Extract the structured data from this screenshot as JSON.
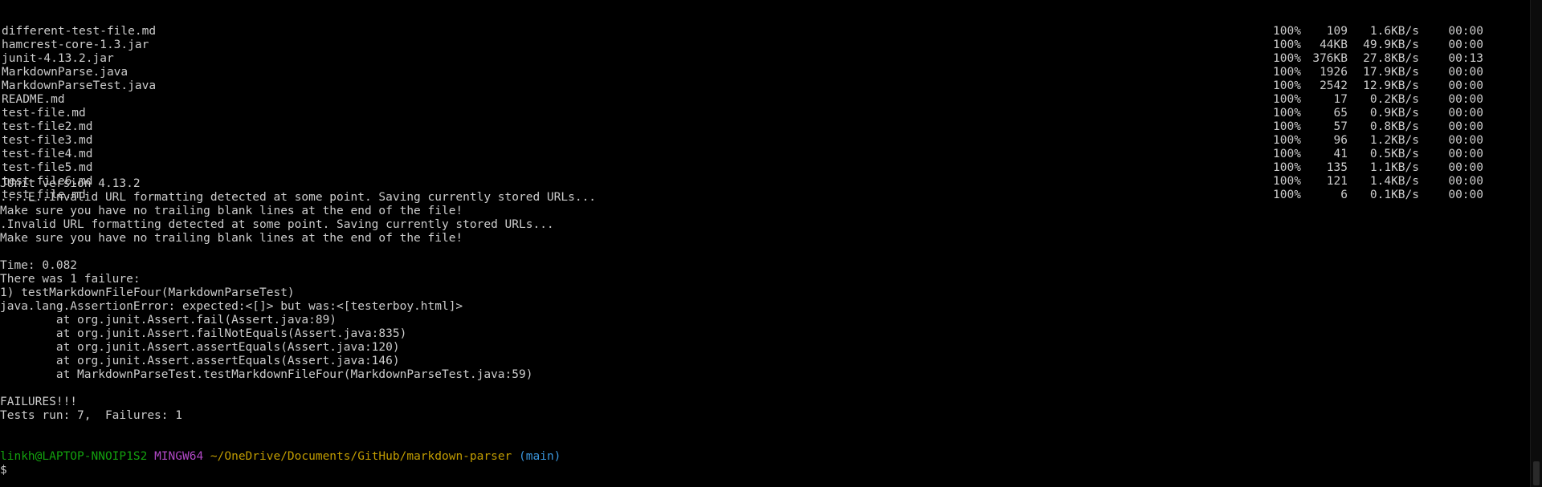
{
  "transfers": [
    {
      "file": "different-test-file.md",
      "percent": "100%",
      "size": "109",
      "rate": "1.6KB/s",
      "eta": "00:00"
    },
    {
      "file": "hamcrest-core-1.3.jar",
      "percent": "100%",
      "size": "44KB",
      "rate": "49.9KB/s",
      "eta": "00:00"
    },
    {
      "file": "junit-4.13.2.jar",
      "percent": "100%",
      "size": "376KB",
      "rate": "27.8KB/s",
      "eta": "00:13"
    },
    {
      "file": "MarkdownParse.java",
      "percent": "100%",
      "size": "1926",
      "rate": "17.9KB/s",
      "eta": "00:00"
    },
    {
      "file": "MarkdownParseTest.java",
      "percent": "100%",
      "size": "2542",
      "rate": "12.9KB/s",
      "eta": "00:00"
    },
    {
      "file": "README.md",
      "percent": "100%",
      "size": "17",
      "rate": "0.2KB/s",
      "eta": "00:00"
    },
    {
      "file": "test-file.md",
      "percent": "100%",
      "size": "65",
      "rate": "0.9KB/s",
      "eta": "00:00"
    },
    {
      "file": "test-file2.md",
      "percent": "100%",
      "size": "57",
      "rate": "0.8KB/s",
      "eta": "00:00"
    },
    {
      "file": "test-file3.md",
      "percent": "100%",
      "size": "96",
      "rate": "1.2KB/s",
      "eta": "00:00"
    },
    {
      "file": "test-file4.md",
      "percent": "100%",
      "size": "41",
      "rate": "0.5KB/s",
      "eta": "00:00"
    },
    {
      "file": "test-file5.md",
      "percent": "100%",
      "size": "135",
      "rate": "1.1KB/s",
      "eta": "00:00"
    },
    {
      "file": "test-file6.md",
      "percent": "100%",
      "size": "121",
      "rate": "1.4KB/s",
      "eta": "00:00"
    },
    {
      "file": "test_file.md",
      "percent": "100%",
      "size": "6",
      "rate": "0.1KB/s",
      "eta": "00:00"
    }
  ],
  "output": {
    "junit_version": "JUnit version 4.13.2",
    "run_line_1": "....E..Invalid URL formatting detected at some point. Saving currently stored URLs...",
    "warn_line_1": "Make sure you have no trailing blank lines at the end of the file!",
    "run_line_2": ".Invalid URL formatting detected at some point. Saving currently stored URLs...",
    "warn_line_2": "Make sure you have no trailing blank lines at the end of the file!",
    "time": "Time: 0.082",
    "failure_count": "There was 1 failure:",
    "failure_test": "1) testMarkdownFileFour(MarkdownParseTest)",
    "assertion_error": "java.lang.AssertionError: expected:<[]> but was:<[testerboy.html]>",
    "stack": [
      "        at org.junit.Assert.fail(Assert.java:89)",
      "        at org.junit.Assert.failNotEquals(Assert.java:835)",
      "        at org.junit.Assert.assertEquals(Assert.java:120)",
      "        at org.junit.Assert.assertEquals(Assert.java:146)",
      "        at MarkdownParseTest.testMarkdownFileFour(MarkdownParseTest.java:59)"
    ],
    "failures_banner": "FAILURES!!!",
    "tests_summary": "Tests run: 7,  Failures: 1"
  },
  "prompt": {
    "user_host": "linkh@LAPTOP-NNOIP1S2",
    "shell": "MINGW64",
    "path": "~/OneDrive/Documents/GitHub/markdown-parser",
    "branch": "(main)",
    "symbol": "$"
  },
  "colors": {
    "background": "#000000",
    "text": "#cccccc",
    "user_host": "#13a10e",
    "shell": "#b148c6",
    "path": "#c19c00",
    "branch": "#3a96dd"
  }
}
